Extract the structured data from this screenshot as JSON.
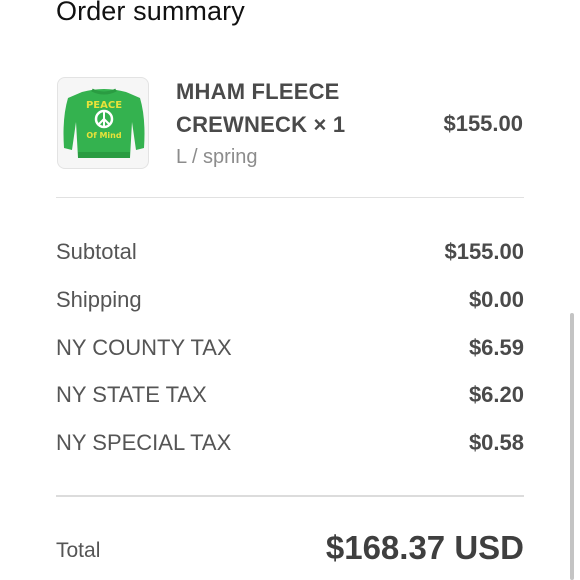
{
  "header": {
    "title": "Order summary"
  },
  "item": {
    "name_line1": "MHAM FLEECE",
    "name_line2": "CREWNECK × 1",
    "variant": "L / spring",
    "price": "$155.00",
    "thumbnail_colors": {
      "sweater": "#34b24f",
      "print": "#e8e23a",
      "peace": "#ffffff"
    }
  },
  "summary": {
    "rows": [
      {
        "label": "Subtotal",
        "value": "$155.00"
      },
      {
        "label": "Shipping",
        "value": "$0.00"
      },
      {
        "label": "NY COUNTY TAX",
        "value": "$6.59"
      },
      {
        "label": "NY STATE TAX",
        "value": "$6.20"
      },
      {
        "label": "NY SPECIAL TAX",
        "value": "$0.58"
      }
    ],
    "total_label": "Total",
    "total_value": "$168.37 USD"
  }
}
